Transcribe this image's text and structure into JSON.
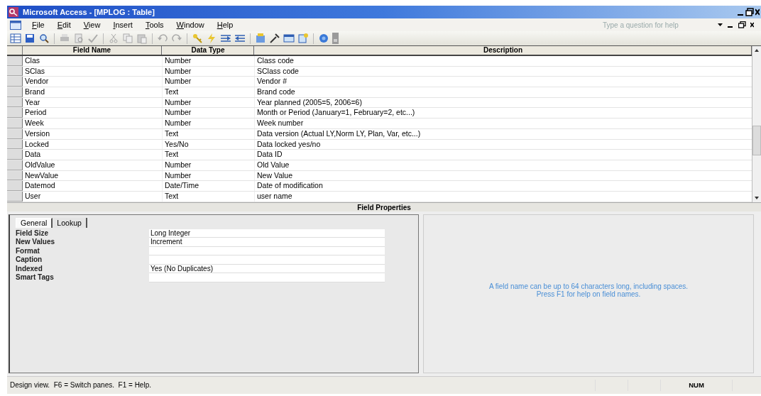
{
  "window": {
    "title": "Microsoft Access - [MPLOG : Table]"
  },
  "menu": [
    "File",
    "Edit",
    "View",
    "Insert",
    "Tools",
    "Window",
    "Help"
  ],
  "help_box": {
    "placeholder": "Type a question for help"
  },
  "table": {
    "columns": [
      "Field Name",
      "Data Type",
      "Description"
    ],
    "rows": [
      {
        "field_name": "Clas",
        "data_type": "Number",
        "description": "Class code"
      },
      {
        "field_name": "SClas",
        "data_type": "Number",
        "description": "SClass code"
      },
      {
        "field_name": "Vendor",
        "data_type": "Number",
        "description": "Vendor #"
      },
      {
        "field_name": "Brand",
        "data_type": "Text",
        "description": "Brand code"
      },
      {
        "field_name": "Year",
        "data_type": "Number",
        "description": "Year planned (2005=5, 2006=6)"
      },
      {
        "field_name": "Period",
        "data_type": "Number",
        "description": "Month or Period (January=1, February=2, etc...)"
      },
      {
        "field_name": "Week",
        "data_type": "Number",
        "description": "Week number"
      },
      {
        "field_name": "Version",
        "data_type": "Text",
        "description": "Data version (Actual LY,Norm LY, Plan, Var, etc...)"
      },
      {
        "field_name": "Locked",
        "data_type": "Yes/No",
        "description": "Data locked yes/no"
      },
      {
        "field_name": "Data",
        "data_type": "Text",
        "description": "Data ID"
      },
      {
        "field_name": "OldValue",
        "data_type": "Number",
        "description": "Old Value"
      },
      {
        "field_name": "NewValue",
        "data_type": "Number",
        "description": "New Value"
      },
      {
        "field_name": "Datemod",
        "data_type": "Date/Time",
        "description": "Date of modification"
      },
      {
        "field_name": "User",
        "data_type": "Text",
        "description": "user name"
      }
    ]
  },
  "field_properties": {
    "title": "Field Properties",
    "tabs": [
      {
        "label": "General",
        "selected": true
      },
      {
        "label": "Lookup",
        "selected": false
      }
    ],
    "properties": [
      {
        "name": "Field Size",
        "value": "Long Integer"
      },
      {
        "name": "New Values",
        "value": "Increment"
      },
      {
        "name": "Format"
      },
      {
        "name": "Caption"
      },
      {
        "name": "Indexed",
        "value": "Yes (No Duplicates)"
      },
      {
        "name": "Smart Tags"
      }
    ],
    "hint": [
      "A field name can be up to 64 characters long, including spaces.",
      "Press F1 for help on field names."
    ]
  },
  "status_bar": {
    "text": "Design view.  F6 = Switch panes.  F1 = Help.",
    "indicators": [
      "NUM"
    ]
  }
}
